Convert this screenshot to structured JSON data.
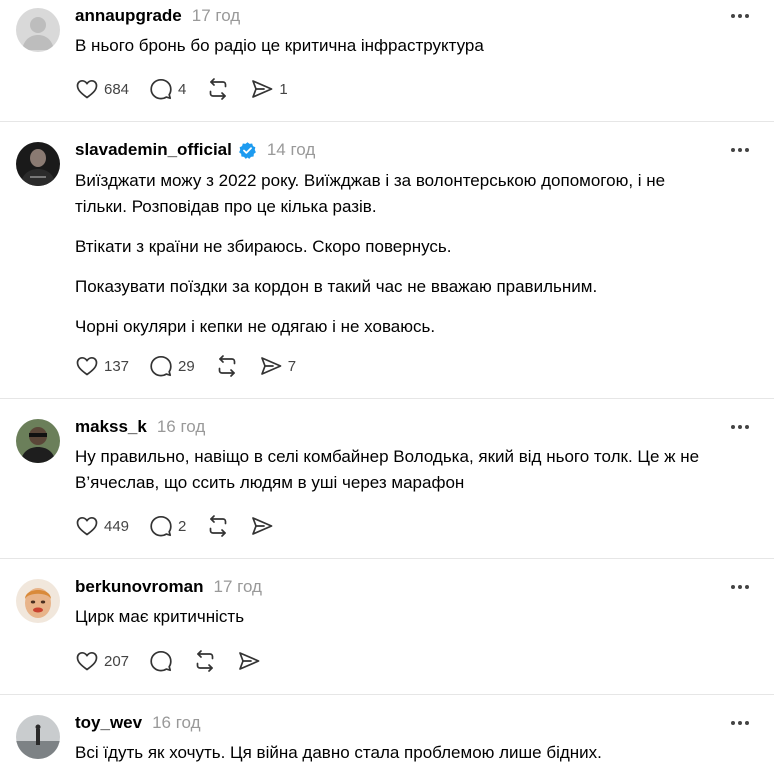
{
  "posts": [
    {
      "username": "annaupgrade",
      "time": "17 год",
      "verified": false,
      "paragraphs": [
        "В нього бронь бо радіо це критична інфраструктура"
      ],
      "likes": "684",
      "replies": "4",
      "reposts": "",
      "shares": "1"
    },
    {
      "username": "slavademin_official",
      "time": "14 год",
      "verified": true,
      "paragraphs": [
        "Виїзджати можу з 2022 року. Виїжджав і за волонтерською допомогою, і не тільки. Розповідав про це кілька разів.",
        "Втікати з країни не збираюсь. Скоро повернусь.",
        "Показувати поїздки за кордон в такий час не вважаю правильним.",
        "Чорні окуляри і кепки не одягаю і не ховаюсь."
      ],
      "likes": "137",
      "replies": "29",
      "reposts": "",
      "shares": "7"
    },
    {
      "username": "makss_k",
      "time": "16 год",
      "verified": false,
      "paragraphs": [
        "Ну правильно, навіщо в селі комбайнер Володька, який від нього толк. Це ж не В’ячеслав, що ссить людям в уші через марафон"
      ],
      "likes": "449",
      "replies": "2",
      "reposts": "",
      "shares": ""
    },
    {
      "username": "berkunovroman",
      "time": "17 год",
      "verified": false,
      "paragraphs": [
        "Цирк має критичність"
      ],
      "likes": "207",
      "replies": "",
      "reposts": "",
      "shares": ""
    },
    {
      "username": "toy_wev",
      "time": "16 год",
      "verified": false,
      "paragraphs": [
        "Всі їдуть як хочуть. Ця війна давно стала проблемою лише бідних."
      ],
      "likes": "",
      "replies": "",
      "reposts": "",
      "shares": ""
    }
  ],
  "icons": {
    "like": "heart-icon",
    "reply": "comment-icon",
    "repost": "repost-icon",
    "share": "send-icon",
    "more": "more-horizontal-icon",
    "verified": "verified-badge-icon"
  },
  "colors": {
    "verified": "#1d9bf0",
    "time": "#999999",
    "divider": "#e6e6e6"
  }
}
